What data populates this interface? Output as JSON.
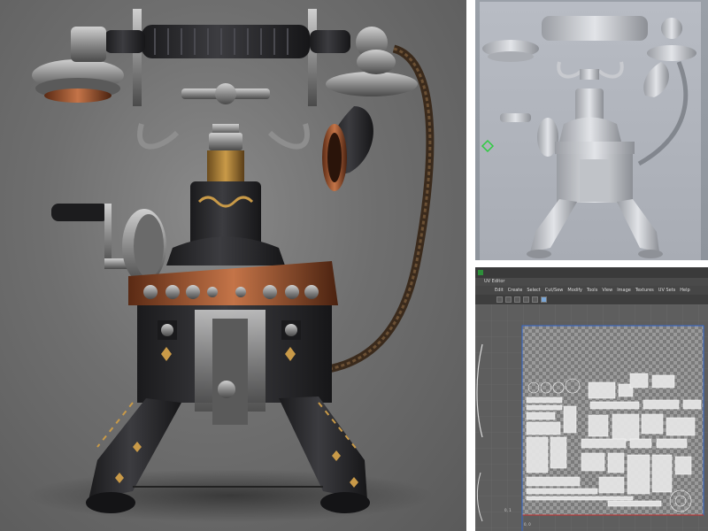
{
  "collage": {
    "panels": [
      "render",
      "viewport",
      "uv-editor"
    ]
  },
  "uv_editor": {
    "window_title": "UV Editor",
    "menu": [
      "Edit",
      "Create",
      "Select",
      "Cut/Sew",
      "Modify",
      "Tools",
      "View",
      "Image",
      "Textures",
      "UV Sets",
      "Help"
    ],
    "tools": [
      "select-tool",
      "move-tool",
      "rotate-tool",
      "scale-tool",
      "uv-shell-tool",
      "checker-tool"
    ],
    "active_tool": "checker-tool",
    "coord_zero_bottom": "0, 1",
    "coord_zero_left": "0, 0"
  },
  "colors": {
    "render_bg": "#6f6f6f",
    "viewport_bg": "#9aa0a8",
    "uv_bg": "#5e5e5e",
    "uv_grid": "#6b6b6b",
    "uv_shell": "#ffffff",
    "uv_frame": "#3366cc",
    "uv_axis_red": "#c83232",
    "brass": "#b58a3c",
    "copper": "#b4633a",
    "metal_dark": "#2a2a2c",
    "metal_steel": "#9a9a9a"
  }
}
